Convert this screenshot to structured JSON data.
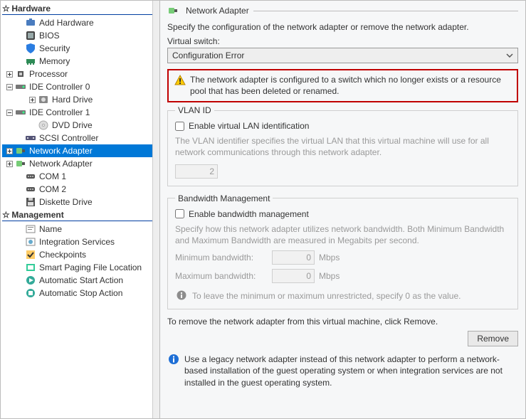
{
  "tree": {
    "hardware_header": "Hardware",
    "management_header": "Management",
    "hardware_items": [
      {
        "label": "Add Hardware",
        "icon": "add-hw",
        "indent": 1,
        "expander": "none"
      },
      {
        "label": "BIOS",
        "icon": "bios",
        "indent": 1,
        "expander": "none"
      },
      {
        "label": "Security",
        "icon": "security",
        "indent": 1,
        "expander": "none"
      },
      {
        "label": "Memory",
        "icon": "memory",
        "indent": 1,
        "expander": "none"
      },
      {
        "label": "Processor",
        "icon": "cpu",
        "indent": 0,
        "expander": "plus"
      },
      {
        "label": "IDE Controller 0",
        "icon": "ide",
        "indent": 0,
        "expander": "minus"
      },
      {
        "label": "Hard Drive",
        "icon": "hdd",
        "indent": 2,
        "expander": "plus"
      },
      {
        "label": "IDE Controller 1",
        "icon": "ide",
        "indent": 0,
        "expander": "minus"
      },
      {
        "label": "DVD Drive",
        "icon": "dvd",
        "indent": 2,
        "expander": "none"
      },
      {
        "label": "SCSI Controller",
        "icon": "scsi",
        "indent": 1,
        "expander": "none"
      },
      {
        "label": "Network Adapter",
        "icon": "nic",
        "indent": 0,
        "expander": "plus",
        "selected": true
      },
      {
        "label": "Network Adapter",
        "icon": "nic",
        "indent": 0,
        "expander": "plus"
      },
      {
        "label": "COM 1",
        "icon": "com",
        "indent": 1,
        "expander": "none"
      },
      {
        "label": "COM 2",
        "icon": "com",
        "indent": 1,
        "expander": "none"
      },
      {
        "label": "Diskette Drive",
        "icon": "floppy",
        "indent": 1,
        "expander": "none"
      }
    ],
    "management_items": [
      {
        "label": "Name",
        "icon": "name"
      },
      {
        "label": "Integration Services",
        "icon": "integ"
      },
      {
        "label": "Checkpoints",
        "icon": "check"
      },
      {
        "label": "Smart Paging File Location",
        "icon": "paging"
      },
      {
        "label": "Automatic Start Action",
        "icon": "autostart"
      },
      {
        "label": "Automatic Stop Action",
        "icon": "autostop"
      }
    ]
  },
  "panel": {
    "title": "Network Adapter",
    "intro": "Specify the configuration of the network adapter or remove the network adapter.",
    "virtual_switch_label": "Virtual switch:",
    "virtual_switch_value": "Configuration Error",
    "warning_text": "The network adapter is configured to a switch which no longer exists or a resource pool that has been deleted or renamed.",
    "vlan": {
      "legend": "VLAN ID",
      "checkbox_label": "Enable virtual LAN identification",
      "help": "The VLAN identifier specifies the virtual LAN that this virtual machine will use for all network communications through this network adapter.",
      "value": "2"
    },
    "bw": {
      "legend": "Bandwidth Management",
      "checkbox_label": "Enable bandwidth management",
      "help": "Specify how this network adapter utilizes network bandwidth. Both Minimum Bandwidth and Maximum Bandwidth are measured in Megabits per second.",
      "min_label": "Minimum bandwidth:",
      "min_value": "0",
      "max_label": "Maximum bandwidth:",
      "max_value": "0",
      "unit": "Mbps",
      "note": "To leave the minimum or maximum unrestricted, specify 0 as the value."
    },
    "remove_text": "To remove the network adapter from this virtual machine, click Remove.",
    "remove_button": "Remove",
    "legacy_hint": "Use a legacy network adapter instead of this network adapter to perform a network-based installation of the guest operating system or when integration services are not installed in the guest operating system."
  }
}
